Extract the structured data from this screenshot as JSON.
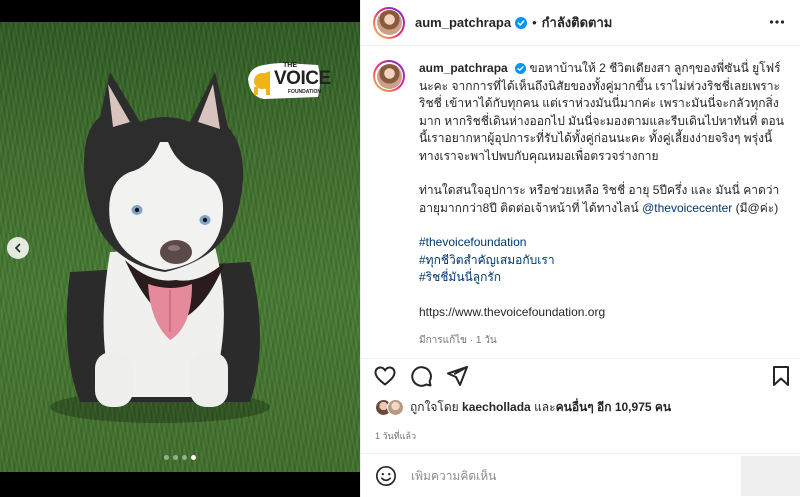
{
  "header": {
    "username": "aum_patchrapa",
    "separator": "•",
    "follow_status": "กำลังติดตาม"
  },
  "media": {
    "logo": {
      "line1": "THE",
      "line2": "VOICE",
      "line3": "FOUNDATION"
    },
    "carousel_count": 4,
    "carousel_active": 4
  },
  "caption": {
    "username": "aum_patchrapa",
    "para1": "ขอหาบ้านให้ 2 ชีวิตเดียงสา ลูกๆของพี่ซันนี่ ยูโฟร์ นะคะ จากการที่ได้เห็นถึงนิสัยของทั้งคู่มากขึ้น เราไม่ห่วงริชชี่เลยเพราะริชชี่ เข้าหาได้กับทุกคน แต่เราห่วงมันนี่มากค่ะ เพราะมันนี่จะกลัวทุกสิ่งมาก หากริชชี่เดินห่างออกไป มันนี่จะมองตามและรีบเดินไปหาทันที่ ตอนนี้เราอยากหาผู้อุปการะที่รับได้ทั้งคู่ก่อนนะคะ ทั้งคู่เลี้ยงง่ายจริงๆ พรุ่งนี้ทางเราจะพาไปพบกับคุณหมอเพื่อตรวจร่างกาย",
    "para2_text": "ท่านใดสนใจอุปการะ หรือช่วยเหลือ ริชชี่ อายุ 5ปีครึ่ง และ มันนี่ คาดว่าอายุมากกว่า8ปี ติดต่อเจ้าหน้าที่ ได้ทางไลน์ ",
    "para2_mention": "@thevoicecenter",
    "para2_end": " (มี@ค่ะ)",
    "hashtags": [
      "#thevoicefoundation",
      "#ทุกชีวิตสำคัญเสมอกับเรา",
      "#ริชชี่มันนี่ลูกรัก"
    ],
    "url": "https://www.thevoicefoundation.org",
    "meta": "มีการแก้ไข · 1 วัน"
  },
  "likes": {
    "prefix": "ถูกใจโดย ",
    "user": "kaechollada",
    "middle": " และ",
    "others": "คนอื่นๆ อีก 10,975 คน"
  },
  "timestamp": "1 วันที่แล้ว",
  "comment": {
    "placeholder": "เพิ่มความคิดเห็น"
  },
  "colors": {
    "link": "#00376b",
    "verified": "#0095f6",
    "meta": "#737373"
  }
}
